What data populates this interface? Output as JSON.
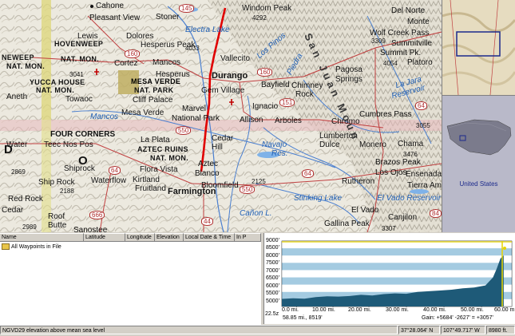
{
  "map": {
    "labels": {
      "cahone": "Cahone",
      "pleasant_view": "Pleasant View",
      "stoner": "Stoner",
      "windom_peak": "Windom Peak",
      "windom_el": "4292",
      "electra_lake": "Electra Lake",
      "lewis": "Lewis",
      "hovenweep": "HOVENWEEP",
      "nat_mon1": "NAT. MON.",
      "dolores": "Dolores",
      "hesperus_peak": "Hesperus Peak",
      "hesperus_el": "4033",
      "vallecito": "Vallecito",
      "cortez": "Cortez",
      "mancos": "Mancos",
      "yucca_house": "YUCCA HOUSE",
      "nat_mon2": "NAT. MON.",
      "towaoc": "Towaoc",
      "el_3041": "3041",
      "mesa_verde": "MESA VERDE",
      "nat_park": "NAT. PARK",
      "cliff_palace": "Cliff Palace",
      "hesperus": "Hesperus",
      "durango": "Durango",
      "bayfield": "Bayfield",
      "gem_village": "Gem Village",
      "chimney": "Chimney",
      "rock": "Rock",
      "aneth": "Aneth",
      "neweep": "NEWEEP",
      "nat_mon3": "NAT. MON.",
      "ignacio": "Ignacio",
      "pagosa": "Pagosa",
      "springs": "Springs",
      "marvel": "Marvel",
      "national_park": "National Park",
      "mesa_verde2": "Mesa Verde",
      "mancos_river": "Mancos",
      "allison": "Allison",
      "arboles": "Arboles",
      "four_corners": "FOUR CORNERS",
      "water": "Water",
      "teec_nos_pos": "Teec Nos Pos",
      "la_plata": "La Plata",
      "aztec_ruins": "AZTEC RUINS",
      "nat_mon4": "NAT. MON.",
      "cedar": "Cedar",
      "hill": "Hill",
      "navajo": "Navajo",
      "res": "Res.",
      "lumberton": "Lumberton",
      "dulce": "Dulce",
      "monero": "Monero",
      "chromo": "Chromo",
      "cumbres_pass": "Cumbres Pass",
      "el_3055": "3055",
      "chama": "Chama",
      "aztec": "Aztec",
      "blanco": "Blanco",
      "shiprock": "Shiprock",
      "flora_vista": "Flora Vista",
      "waterflow": "Waterflow",
      "kirtland": "Kirtland",
      "fruitland": "Fruitland",
      "farmington": "Farmington",
      "bloomfield": "Bloomfield",
      "el_2125": "2125",
      "ship_rock": "Ship Rock",
      "el_2188": "2188",
      "el_2869": "2869",
      "red_rock": "Red Rock",
      "cedar_ridge": "Cedar",
      "stinking_lake": "Stinking Lake",
      "canon": "Cañon L.",
      "rutheron": "Rutheron",
      "el_vado": "El Vado",
      "el_vado_res": "El Vado Reservoir",
      "los_ojos": "Los Ojos",
      "brazos_peak": "Brazos Peak",
      "el_3476": "3476",
      "ensenada": "Ensenada",
      "tierra_am": "Tierra Am",
      "canjilon": "Canjilon",
      "gallina_peak": "Gallina Peak",
      "el_3307": "3307",
      "roof": "Roof",
      "butte": "Butte",
      "el_2989": "2989",
      "sanostee": "Sanostee",
      "del_norte": "Del Norte",
      "monte": "Monte",
      "wolf_creek_pass": "Wolf Creek Pass",
      "el_3309": "3309",
      "summitville": "Summitville",
      "summit_pk": "Summit Pk.",
      "el_4054": "4054",
      "platoro": "Platoro",
      "la_jara": "La Jara",
      "reservoir": "Reservoir",
      "san_juan_mtns": "San Juan Moun",
      "los_pinos": "Los Pinos",
      "piedra": "Piedra",
      "d_letter": "D",
      "o_letter": "O"
    },
    "shields": [
      "145",
      "160",
      "160",
      "151",
      "550",
      "64",
      "64",
      "64",
      "550",
      "666",
      "44",
      "84"
    ]
  },
  "overview": {
    "title": "",
    "bg": "#e8e0c8",
    "box_color": "#1c2a8c"
  },
  "us_panel": {
    "label": "United States"
  },
  "waypoints": {
    "columns": [
      "Name",
      "Latitude",
      "Longitude",
      "Elevation",
      "Local Date & Time",
      "In P"
    ],
    "rows": [
      {
        "label": "All Waypoints in File"
      }
    ]
  },
  "profile": {
    "y_labels": [
      "9000'",
      "8500'",
      "8000'",
      "7500'",
      "7000'",
      "6500'",
      "6000'",
      "5500'",
      "5000'"
    ],
    "x_labels": [
      "0.0 mi.",
      "10.00 mi.",
      "20.00 mi.",
      "30.00 mi.",
      "40.00 mi.",
      "50.00 mi.",
      "60.00 m"
    ],
    "zoom": "22.5z",
    "range": "58.85 mi., 8519'",
    "gain": "Gain: +5684' -2627' = +3057'",
    "fill_color": "#1e5a78",
    "band_color": "#5aa0c8"
  },
  "status": {
    "datum": "NGVD29 elevation above mean sea level",
    "lat": "37°28.064' N",
    "lon": "107°49.717' W",
    "elev": "8980 ft."
  }
}
